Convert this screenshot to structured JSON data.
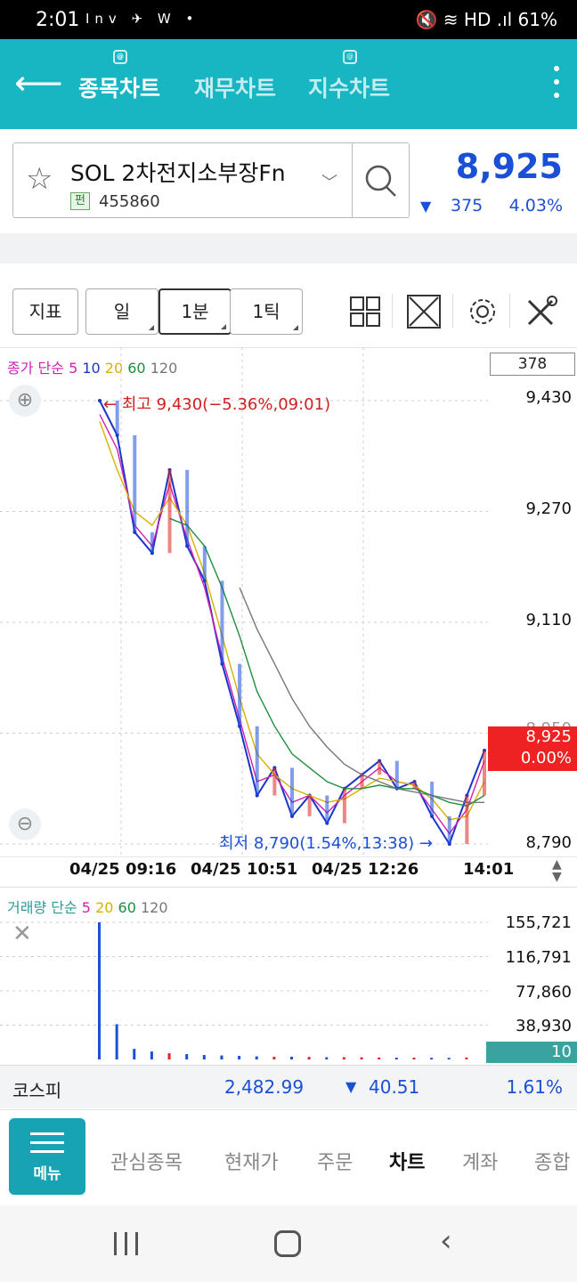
{
  "status_bar": {
    "time": "2:01",
    "icons": "Inv ✈ W •",
    "right_text": "🔇 ≋ HD .ıl 61%"
  },
  "app_bar": {
    "back_icon": "back-arrow-icon",
    "tabs": [
      {
        "label": "종목차트",
        "active": true
      },
      {
        "label": "재무차트",
        "active": false
      },
      {
        "label": "지수차트",
        "active": false
      }
    ],
    "more_icon": "more-vertical-icon"
  },
  "stock": {
    "name": "SOL 2차전지소부장Fn",
    "badge": "펀",
    "code": "455860",
    "price": "8,925",
    "change_arrow": "▼",
    "change": "375",
    "change_pct": "4.03%"
  },
  "toolbar": {
    "indicator": "지표",
    "periods": [
      {
        "label": "일",
        "selected": false
      },
      {
        "label": "1분",
        "selected": true
      },
      {
        "label": "1틱",
        "selected": false
      }
    ],
    "icons": [
      "layout-grid-icon",
      "expand-icon",
      "settings-gear-icon",
      "tools-icon"
    ]
  },
  "price_chart": {
    "legend": {
      "prefix": "종가 단순",
      "ma": [
        "5",
        "10",
        "20",
        "60",
        "120"
      ]
    },
    "volume_box": "378",
    "y_ticks": [
      "9,430",
      "9,270",
      "9,110",
      "8,950",
      "8,790"
    ],
    "x_ticks": [
      "04/25 09:16",
      "04/25 10:51",
      "04/25 12:26",
      "14:01"
    ],
    "high_label": "최고 9,430(−5.36%,09:01)",
    "low_label": "최저 8,790(1.54%,13:38)",
    "current_price": "8,925",
    "current_pct": "0.00%"
  },
  "volume_chart": {
    "legend": {
      "prefix": "거래량 단순",
      "ma": [
        "5",
        "20",
        "60",
        "120"
      ]
    },
    "y_ticks": [
      "155,721",
      "116,791",
      "77,860",
      "38,930"
    ],
    "current": "10"
  },
  "kospi": {
    "label": "코스피",
    "value": "2,482.99",
    "arrow": "▼",
    "change": "40.51",
    "pct": "1.61%"
  },
  "bottom_nav": {
    "menu": "메뉴",
    "items": [
      {
        "label": "관심종목",
        "active": false
      },
      {
        "label": "현재가",
        "active": false
      },
      {
        "label": "주문",
        "active": false
      },
      {
        "label": "차트",
        "active": true
      },
      {
        "label": "계좌",
        "active": false
      },
      {
        "label": "종합",
        "active": false
      }
    ]
  },
  "colors": {
    "accent": "#18b5c3",
    "up": "#e22222",
    "down": "#1a4fd8",
    "ma5": "#d21fb0",
    "ma10": "#1c35c9",
    "ma20": "#d8b100",
    "ma60": "#1d8f3d",
    "ma120": "#777777"
  },
  "chart_data": {
    "type": "line",
    "title": "",
    "xlabel": "",
    "ylabel": "",
    "ylim": [
      8790,
      9430
    ],
    "x": [
      "09:01",
      "09:16",
      "09:30",
      "09:45",
      "10:00",
      "10:15",
      "10:30",
      "10:45",
      "10:51",
      "11:05",
      "11:20",
      "11:35",
      "11:50",
      "12:05",
      "12:20",
      "12:26",
      "12:40",
      "12:55",
      "13:10",
      "13:25",
      "13:38",
      "13:50",
      "14:01"
    ],
    "series": [
      {
        "name": "종가",
        "values": [
          9430,
          9380,
          9240,
          9210,
          9330,
          9220,
          9170,
          9050,
          8960,
          8860,
          8900,
          8830,
          8860,
          8820,
          8870,
          8890,
          8910,
          8870,
          8880,
          8830,
          8790,
          8860,
          8925
        ]
      },
      {
        "name": "5",
        "values": [
          9410,
          9360,
          9250,
          9220,
          9310,
          9230,
          9160,
          9060,
          8970,
          8880,
          8890,
          8850,
          8860,
          8835,
          8860,
          8880,
          8900,
          8880,
          8875,
          8840,
          8805,
          8840,
          8910
        ]
      },
      {
        "name": "20",
        "values": [
          9400,
          9330,
          9270,
          9250,
          9290,
          9250,
          9180,
          9090,
          9000,
          8920,
          8890,
          8870,
          8860,
          8850,
          8855,
          8870,
          8885,
          8880,
          8875,
          8855,
          8825,
          8830,
          8880
        ]
      },
      {
        "name": "60",
        "values": [
          null,
          null,
          null,
          null,
          9260,
          9250,
          9220,
          9160,
          9090,
          9010,
          8960,
          8920,
          8900,
          8880,
          8870,
          8870,
          8875,
          8870,
          8870,
          8860,
          8850,
          8845,
          8860
        ]
      },
      {
        "name": "120",
        "values": [
          null,
          null,
          null,
          null,
          null,
          null,
          null,
          null,
          9160,
          9100,
          9050,
          9000,
          8960,
          8930,
          8905,
          8890,
          8880,
          8870,
          8865,
          8860,
          8855,
          8850,
          8850
        ]
      }
    ],
    "volume": {
      "ylim": [
        0,
        155721
      ],
      "values": [
        155721,
        40000,
        12000,
        9000,
        7000,
        6000,
        5000,
        4500,
        4000,
        3500,
        3000,
        3000,
        2800,
        2500,
        2500,
        2400,
        2200,
        2000,
        2000,
        1800,
        1800,
        2200,
        10
      ]
    }
  }
}
